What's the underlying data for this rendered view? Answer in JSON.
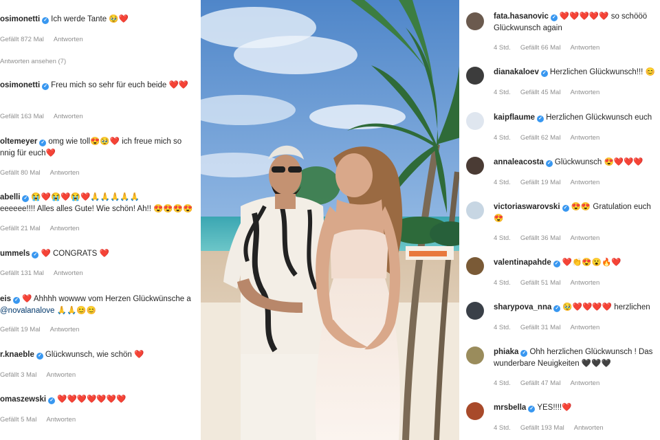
{
  "left_comments": [
    {
      "user": "osimonetti",
      "text": "Ich werde Tante",
      "emoji": "🥹❤️",
      "likes": "Gefällt 872 Mal",
      "reply": "Antworten",
      "extra": "Antworten ansehen (7)"
    },
    {
      "user": "osimonetti",
      "text": "Freu mich so sehr für euch beide",
      "emoji": "❤️❤️",
      "likes": "Gefällt 163 Mal",
      "reply": "Antworten"
    },
    {
      "user": "oltemeyer",
      "text": "omg wie toll",
      "emoji": "😍🥹❤️",
      "text2": "ich freue mich so",
      "line2": "nnig für euch❤️",
      "likes": "Gefällt 80 Mal",
      "reply": "Antworten"
    },
    {
      "user": "abelli",
      "text": "",
      "emoji": "😭❤️😭❤️😭❤️🙏🙏🙏🙏🙏",
      "line2": "eeeeee!!!! Alles alles Gute! Wie schön! Ah!! 😍😍😍😍",
      "likes": "Gefällt 21 Mal",
      "reply": "Antworten"
    },
    {
      "user": "ummels",
      "text": "",
      "emoji": "❤️",
      "text2": "CONGRATS",
      "emoji2": "❤️",
      "likes": "Gefällt 131 Mal",
      "reply": "Antworten"
    },
    {
      "user": "eis",
      "text": "",
      "emoji": "❤️",
      "text2": "Ahhhh wowww vom Herzen Glückwünsche a",
      "line2": "@novalanalove 🙏🙏😊😊",
      "likes": "Gefällt 19 Mal",
      "reply": "Antworten"
    },
    {
      "user": "r.knaeble",
      "text": "Glückwunsch, wie schön",
      "emoji": "❤️",
      "likes": "Gefällt 3 Mal",
      "reply": "Antworten"
    },
    {
      "user": "omaszewski",
      "text": "",
      "emoji": "❤️❤️❤️❤️❤️❤️❤️",
      "likes": "Gefällt 5 Mal",
      "reply": "Antworten"
    }
  ],
  "right_comments": [
    {
      "user": "fata.hasanovic",
      "emoji": "❤️❤️❤️❤️❤️",
      "text": "so schööö",
      "line2": "Glückwunsch again",
      "time": "4 Std.",
      "likes": "Gefällt 66 Mal",
      "reply": "Antworten"
    },
    {
      "user": "dianakaloev",
      "emoji": "",
      "text": "Herzlichen Glückwunsch!!! 😊",
      "time": "4 Std.",
      "likes": "Gefällt 45 Mal",
      "reply": "Antworten"
    },
    {
      "user": "kaipflaume",
      "emoji": "",
      "text": "Herzlichen Glückwunsch euch",
      "time": "4 Std.",
      "likes": "Gefällt 62 Mal",
      "reply": "Antworten"
    },
    {
      "user": "annaleacosta",
      "emoji": "",
      "text": "Glückwunsch 😍❤️❤️❤️",
      "time": "4 Std.",
      "likes": "Gefällt 19 Mal",
      "reply": "Antworten"
    },
    {
      "user": "victoriaswarovski",
      "emoji": "😍😍",
      "text": "Gratulation euch",
      "line2": "😍",
      "time": "4 Std.",
      "likes": "Gefällt 36 Mal",
      "reply": "Antworten"
    },
    {
      "user": "valentinapahde",
      "emoji": "❤️👏😍😮🔥❤️",
      "text": "",
      "time": "4 Std.",
      "likes": "Gefällt 51 Mal",
      "reply": "Antworten"
    },
    {
      "user": "sharypova_nna",
      "emoji": "🥹❤️❤️❤️❤️",
      "text": "herzlichen",
      "time": "4 Std.",
      "likes": "Gefällt 31 Mal",
      "reply": "Antworten"
    },
    {
      "user": "phiaka",
      "emoji": "",
      "text": "Ohh herzlichen Glückwunsch ! Das",
      "line2": "wunderbare Neuigkeiten 🖤🖤🖤",
      "time": "4 Std.",
      "likes": "Gefällt 47 Mal",
      "reply": "Antworten"
    },
    {
      "user": "mrsbella",
      "emoji": "",
      "text": "YES!!!!❤️",
      "time": "4 Std.",
      "likes": "Gefällt 193 Mal",
      "reply": "Antworten"
    }
  ],
  "colors": {
    "verified": "#3897f0",
    "meta": "#8e8e8e",
    "heart": "#e0245e"
  }
}
